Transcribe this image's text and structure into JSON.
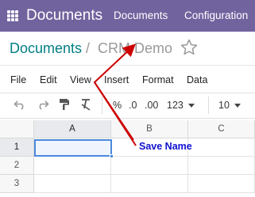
{
  "topbar": {
    "app_name": "Documents",
    "menu": [
      "Documents",
      "Configuration"
    ],
    "background_color": "#71639e"
  },
  "breadcrumb": {
    "parent": "Documents",
    "separator": "/",
    "current": "CRM Demo"
  },
  "menubar": {
    "items": [
      "File",
      "Edit",
      "View",
      "Insert",
      "Format",
      "Data"
    ]
  },
  "toolbar": {
    "percent": "%",
    "decimal_decrease": ".0",
    "decimal_increase": ".00",
    "number_format": "123",
    "font_size": "10"
  },
  "sheet": {
    "columns": [
      "A",
      "B",
      "C"
    ],
    "rows": [
      "1",
      "2",
      "3"
    ],
    "selected_cell": "A1"
  },
  "annotation": {
    "text": "Save Name",
    "color": "#1010d0",
    "arrow_color": "#cc0000"
  }
}
